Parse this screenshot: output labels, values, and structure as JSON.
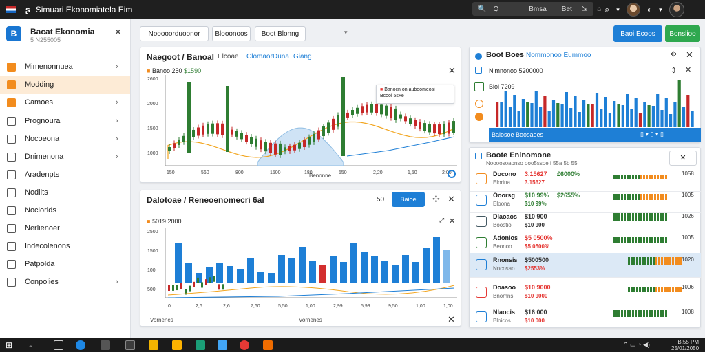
{
  "window": {
    "title": "Simuari Ekonomiatela Eim",
    "search_left": "Q",
    "search_center": "Bmsa",
    "search_right": "Bet",
    "search_btn1": "⇲",
    "search_btn2": "⌂"
  },
  "sidebar": {
    "app_name": "Bacat Ekonomia",
    "app_sub": "5 N255005",
    "items": [
      {
        "label": "Mimenonnuea",
        "chevron": true,
        "active": false
      },
      {
        "label": "Modding",
        "chevron": false,
        "active": true
      },
      {
        "label": "Camoes",
        "chevron": true,
        "active": false
      },
      {
        "label": "Prognoura",
        "chevron": true,
        "active": false
      },
      {
        "label": "Nocoeona",
        "chevron": true,
        "active": false
      },
      {
        "label": "Dnimenona",
        "chevron": true,
        "active": false
      },
      {
        "label": "Aradenpts",
        "chevron": false,
        "active": false
      },
      {
        "label": "Nodiits",
        "chevron": false,
        "active": false
      },
      {
        "label": "Nociorids",
        "chevron": false,
        "active": false
      },
      {
        "label": "Nerlienoer",
        "chevron": false,
        "active": false
      },
      {
        "label": "Indecolenons",
        "chevron": false,
        "active": false
      },
      {
        "label": "Patpolda",
        "chevron": false,
        "active": false
      },
      {
        "label": "Conpolies",
        "chevron": true,
        "active": false
      }
    ]
  },
  "toolbar": {
    "btn1": "Nooooorduoonor",
    "btn2": "Blooonoos",
    "btn3": "Boot Blonng",
    "action_blue": "Baoi Ecoos",
    "action_green": "Bonslioo"
  },
  "chart_top": {
    "title": "Naegoot / Banoal",
    "tabs": [
      "Elcoae",
      "Clomaoe",
      "Duna",
      "Giang"
    ],
    "info_a": "Banoo",
    "info_b": "250",
    "info_c": "$1590",
    "xlabel": "Benonne",
    "legend_1": "Banocn on auboomeosi",
    "legend_2": "Bcooi 5s+e"
  },
  "chart_bottom": {
    "title": "Dalotoae / Reneoenomecri 6al",
    "num": "50",
    "btn": "Baioe",
    "info_a": "5019",
    "info_b": "2000",
    "xlabel": "Vornenes"
  },
  "right_top": {
    "title": "Boot Boes",
    "subtitle": "Nommonoo Eummoo",
    "info_a": "Nimnonoo",
    "info_b": "5200000",
    "row2_a": "Biol",
    "row2_b": "7209",
    "footer": "Baiosoe Boosaoes"
  },
  "right_bottom": {
    "title": "Boote Eninomone",
    "subtitle": "Noooosoaonso ooo5ssoe i 55a 5b 55",
    "rows": [
      {
        "name": "Docono",
        "sub": "Elorina",
        "v1": "3.15627",
        "v2": "3.15627",
        "v3": "£6000%",
        "c1": "#e53935",
        "c2": "#e53935",
        "c3": "#2e7d32",
        "icon": "#f28c1e",
        "val": "1058"
      },
      {
        "name": "Ooorsg",
        "sub": "Eloona",
        "v1": "$10 99%",
        "v2": "$10 99%",
        "v3": "$2655%",
        "c1": "#2e7d32",
        "c2": "#2e7d32",
        "c3": "#2e7d32",
        "icon": "#1e7fd6",
        "val": "1005"
      },
      {
        "name": "Dlaoaos",
        "sub": "Boostio",
        "v1": "$10 900",
        "v2": "$10 900",
        "v3": "",
        "c1": "#333",
        "c2": "#333",
        "c3": "#333",
        "icon": "#455a64",
        "val": "1026"
      },
      {
        "name": "Adonlos",
        "sub": "Beonoo",
        "v1": "$5 0500%",
        "v2": "$5 0500%",
        "v3": "",
        "c1": "#e53935",
        "c2": "#e53935",
        "c3": "#333",
        "icon": "#2e7d32",
        "val": "1005"
      },
      {
        "name": "Rnonsis",
        "sub": "Nncosao",
        "v1": "$500500",
        "v2": "$2553%",
        "v3": "",
        "c1": "#333",
        "c2": "#e53935",
        "c3": "#333",
        "icon": "#1e7fd6",
        "val": "1020"
      },
      {
        "name": "Doasoo",
        "sub": "Bnomns",
        "v1": "$10 9000",
        "v2": "$10 9000",
        "v3": "",
        "c1": "#e53935",
        "c2": "#e53935",
        "c3": "#333",
        "icon": "#e53935",
        "val": "1006"
      },
      {
        "name": "Nlaocis",
        "sub": "Bloicos",
        "v1": "$16 000",
        "v2": "$10 000",
        "v3": "",
        "c1": "#333",
        "c2": "#e53935",
        "c3": "#333",
        "icon": "#1e7fd6",
        "val": "1008"
      }
    ]
  },
  "taskbar": {
    "time": "B:55 PM",
    "date": "25/01/2050"
  },
  "colors": {
    "accent_blue": "#1e7fd6",
    "accent_green": "#2fa84f",
    "accent_orange": "#f28c1e",
    "up": "#2e7d32",
    "down": "#e53935"
  }
}
